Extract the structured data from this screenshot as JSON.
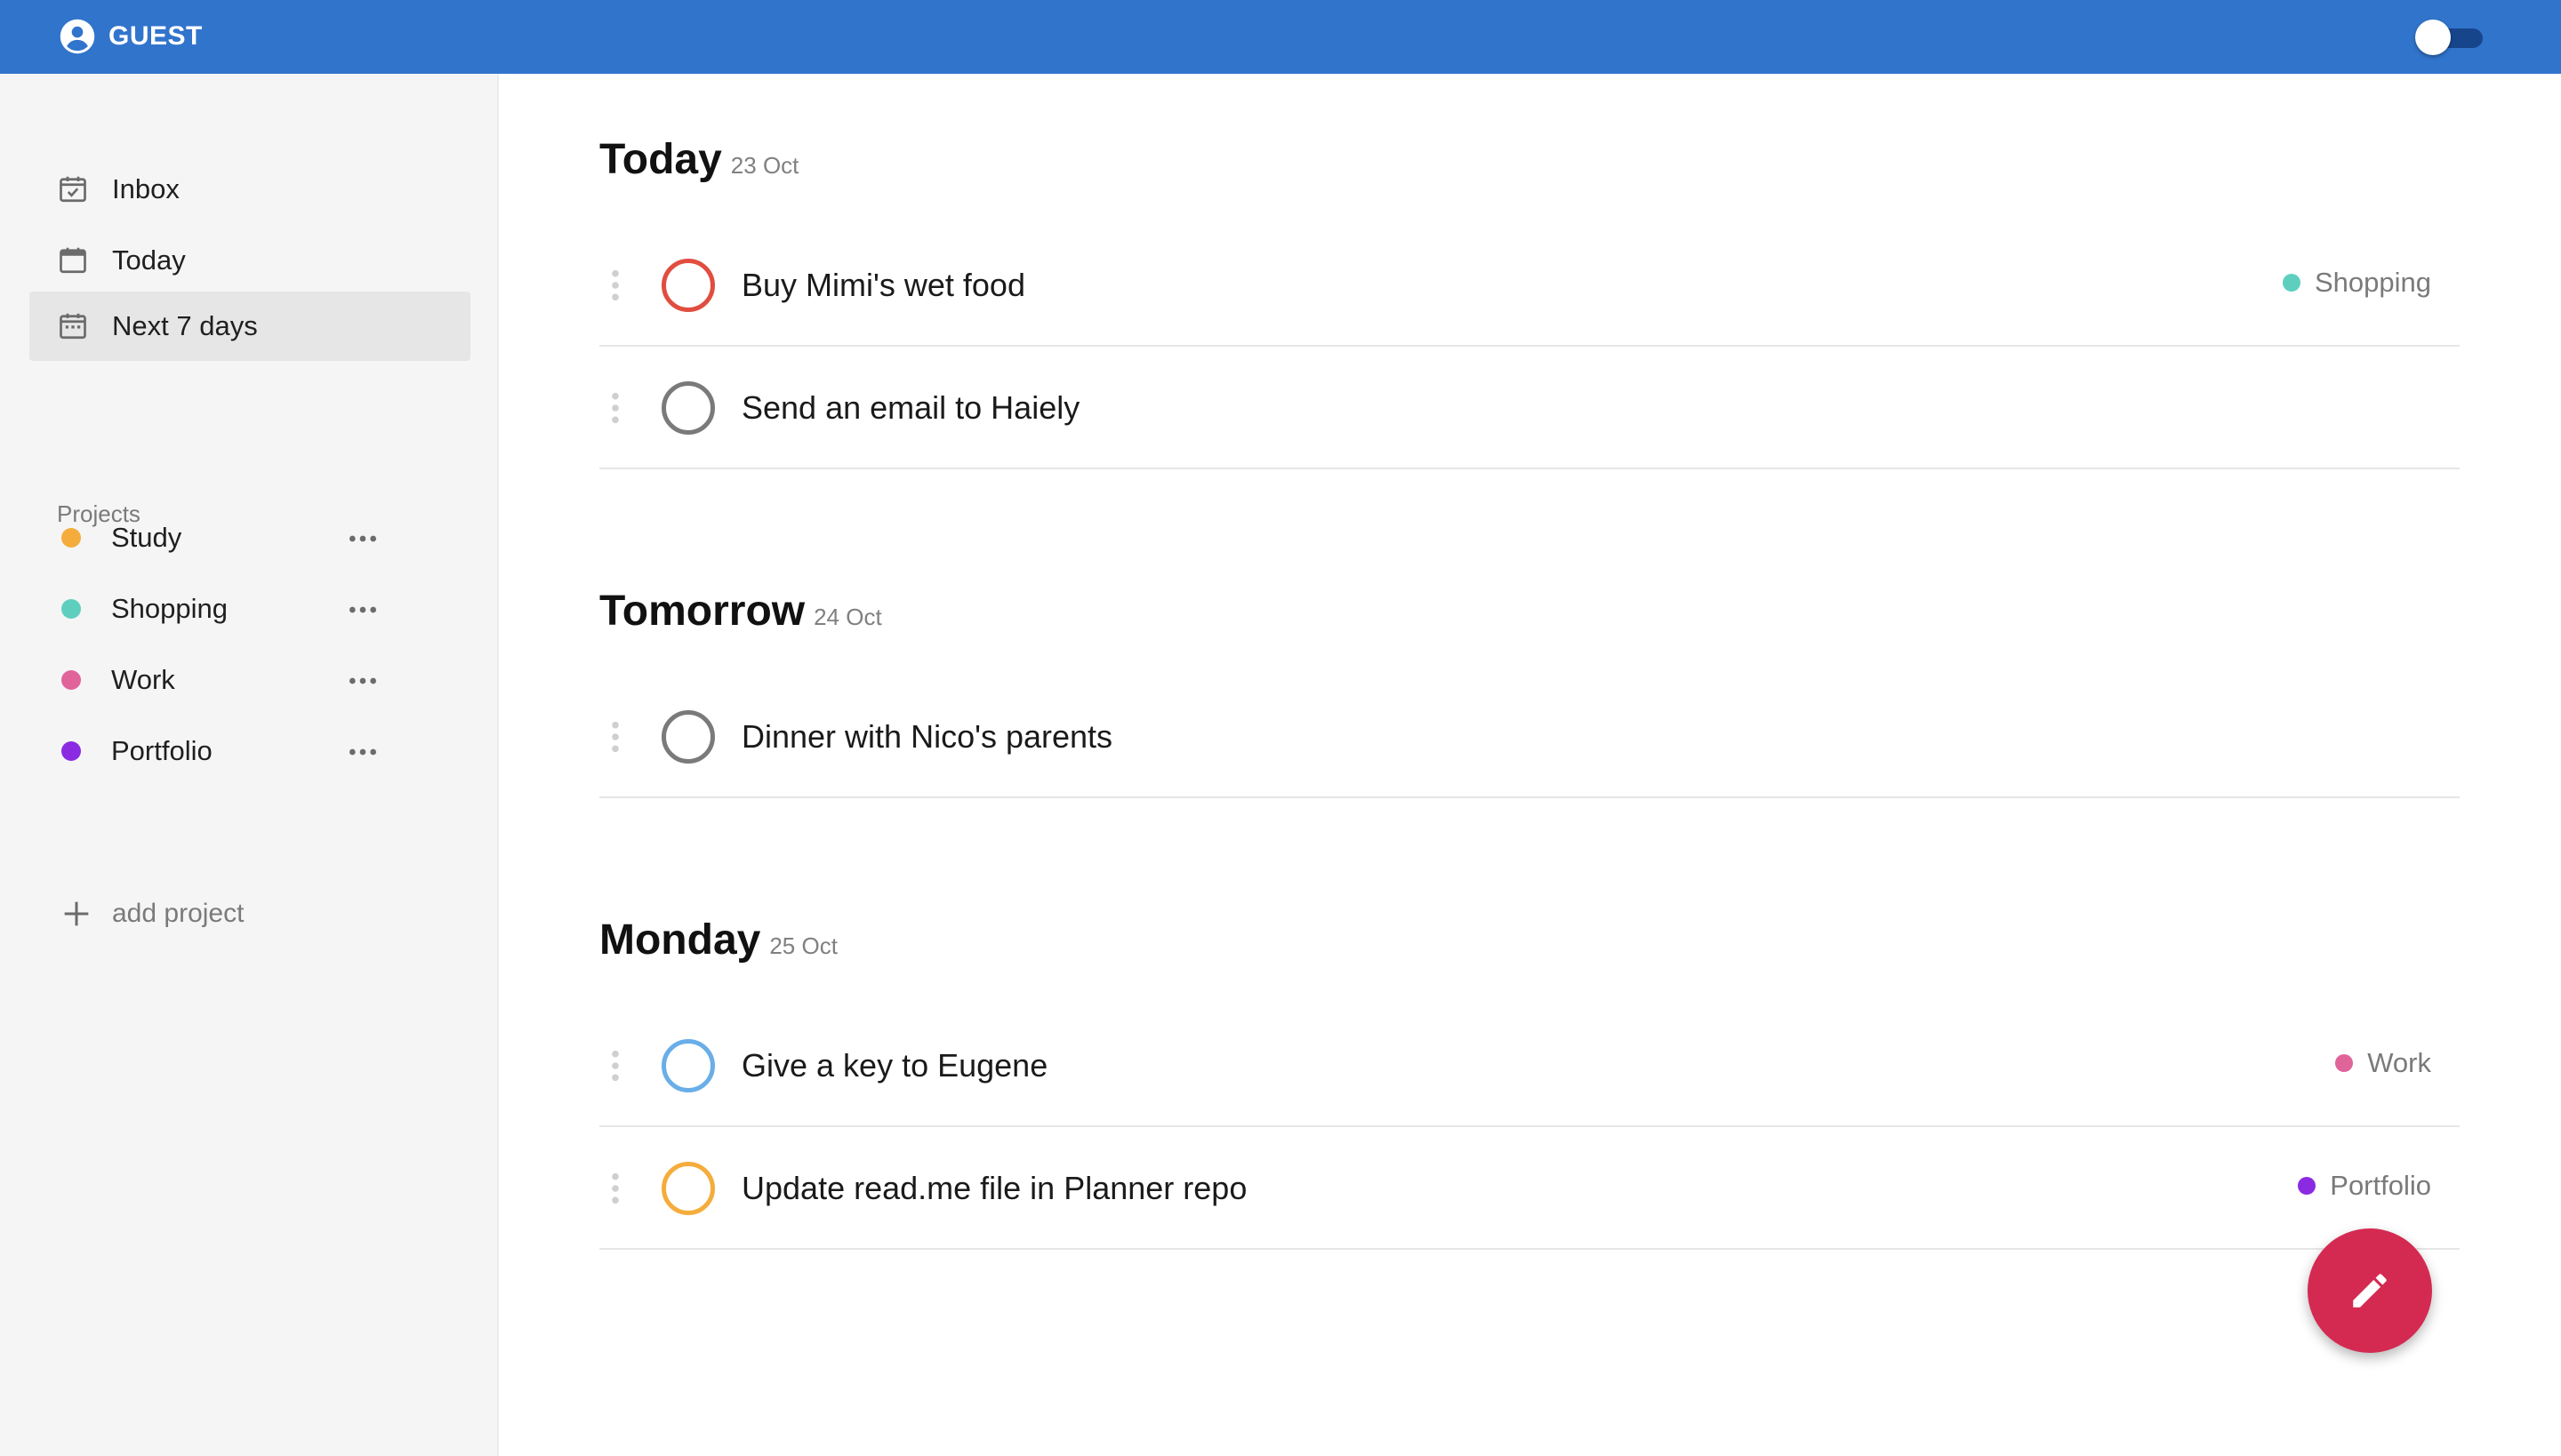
{
  "header": {
    "user_label": "GUEST",
    "user_icon": "account-circle-icon",
    "theme_toggle": {
      "state": "off"
    },
    "accent_color": "#3174cc"
  },
  "sidebar": {
    "nav": [
      {
        "label": "Inbox",
        "icon": "inbox-calendar-check-icon",
        "active": false
      },
      {
        "label": "Today",
        "icon": "calendar-icon",
        "active": false
      },
      {
        "label": "Next 7 days",
        "icon": "calendar-week-icon",
        "active": true
      }
    ],
    "projects_heading": "Projects",
    "projects": [
      {
        "label": "Study",
        "color": "#f4ad3c"
      },
      {
        "label": "Shopping",
        "color": "#5ecfbf"
      },
      {
        "label": "Work",
        "color": "#e0649a"
      },
      {
        "label": "Portfolio",
        "color": "#8a2be2"
      }
    ],
    "add_project_label": "add project"
  },
  "main": {
    "sections": [
      {
        "day": "Today",
        "date": "23 Oct",
        "tasks": [
          {
            "title": "Buy Mimi's wet food",
            "priority_color": "#e14d3f",
            "tag": "Shopping",
            "tag_color": "#5ecfbf"
          },
          {
            "title": "Send an email to Haiely",
            "priority_color": "#7a7a7a",
            "tag": "",
            "tag_color": ""
          }
        ]
      },
      {
        "day": "Tomorrow",
        "date": "24 Oct",
        "tasks": [
          {
            "title": "Dinner with Nico's parents",
            "priority_color": "#7a7a7a",
            "tag": "",
            "tag_color": ""
          }
        ]
      },
      {
        "day": "Monday",
        "date": "25 Oct",
        "tasks": [
          {
            "title": "Give a key to Eugene",
            "priority_color": "#6aaee8",
            "tag": "Work",
            "tag_color": "#e0649a"
          },
          {
            "title": "Update read.me file in Planner repo",
            "priority_color": "#f4ad3c",
            "tag": "Portfolio",
            "tag_color": "#8a2be2"
          }
        ]
      }
    ]
  },
  "fab": {
    "icon": "pencil-edit-icon",
    "color": "#d42a52"
  }
}
